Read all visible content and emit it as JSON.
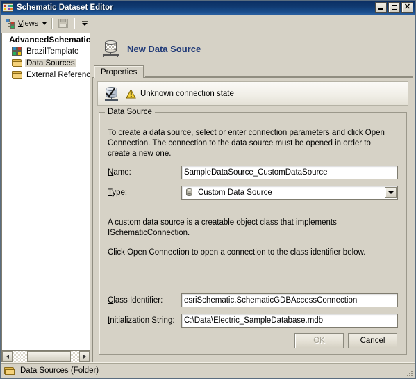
{
  "window": {
    "title": "Schematic Dataset Editor",
    "icon": "schematic-dataset-icon",
    "buttons": {
      "minimize": "_",
      "maximize": "□",
      "close": "✕"
    }
  },
  "toolbar": {
    "views_label": "Views",
    "views_underline": "V",
    "views_icon": "views-tree-icon",
    "dropdown_icon": "chevron-down-icon",
    "save_icon": "save-disk-icon",
    "overflow_icon": "toolbar-overflow-icon"
  },
  "tree": {
    "root": {
      "label": "AdvancedSchematic"
    },
    "items": [
      {
        "label": "BrazilTemplate",
        "icon": "schematic-template-icon",
        "selected": false
      },
      {
        "label": "Data Sources",
        "icon": "folder-icon",
        "selected": true
      },
      {
        "label": "External References",
        "icon": "folder-icon",
        "selected": false
      }
    ],
    "hscroll": {
      "left_arrow": "◀",
      "right_arrow": "▶"
    }
  },
  "details": {
    "header": {
      "icon": "data-source-icon",
      "title": "New Data Source"
    },
    "tabs": [
      {
        "label": "Properties",
        "active": true
      }
    ],
    "connection_state": {
      "icon": "database-check-icon",
      "warning_icon": "warning-triangle-icon",
      "text": "Unknown connection state"
    },
    "groupbox": {
      "title": "Data Source",
      "description": "To create a data source, select or enter connection parameters and click Open Connection.  The connection to the data source must be opened in order to create a new one.",
      "fields": {
        "name": {
          "label": "Name:",
          "accel": "N",
          "value": "SampleDataSource_CustomDataSource",
          "placeholder": ""
        },
        "type": {
          "label": "Type:",
          "accel": "T",
          "value": "Custom Data Source",
          "icon": "database-small-icon",
          "dropdown_icon": "chevron-down-icon"
        },
        "class_identifier": {
          "label": "Class Identifier:",
          "accel": "C",
          "value": "esriSchematic.SchematicGDBAccessConnection",
          "placeholder": ""
        },
        "initialization_string": {
          "label": "Initialization String:",
          "accel": "I",
          "value": "C:\\Data\\Electric_SampleDatabase.mdb",
          "placeholder": ""
        }
      },
      "description2_line1": "A custom data source is a creatable object class that implements",
      "description2_line2": "ISchematicConnection.",
      "description3": "Click Open Connection to open a connection to the class identifier below."
    },
    "buttons": {
      "ok": {
        "label": "OK",
        "disabled": true
      },
      "cancel": {
        "label": "Cancel",
        "disabled": false
      }
    }
  },
  "statusbar": {
    "icon": "folder-icon",
    "text": "Data Sources (Folder)",
    "grip": "resize-grip"
  },
  "colors": {
    "title_bar_start": "#0b2e63",
    "title_bar_end": "#2a5fa0",
    "window_face": "#d6d2c6",
    "accent_heading": "#203a78",
    "field_bg": "#ffffff",
    "border": "#7f7c6f",
    "selection": "#d8d4c8"
  }
}
